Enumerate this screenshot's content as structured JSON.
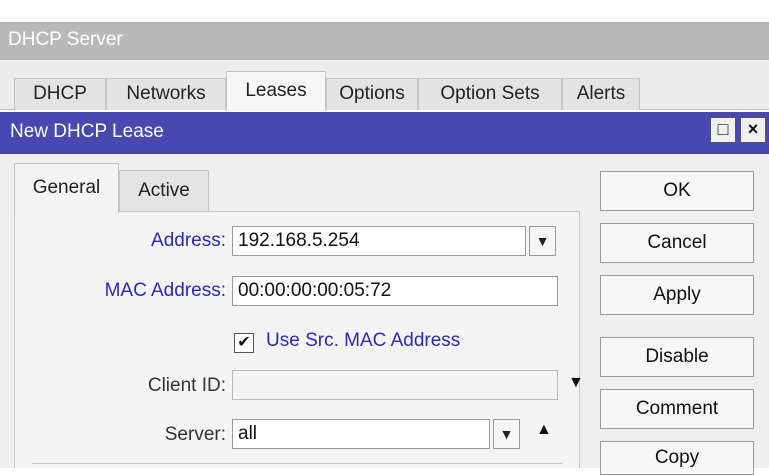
{
  "outer_window": {
    "title": "DHCP Server",
    "tabs": [
      {
        "label": "DHCP"
      },
      {
        "label": "Networks"
      },
      {
        "label": "Leases"
      },
      {
        "label": "Options"
      },
      {
        "label": "Option Sets"
      },
      {
        "label": "Alerts"
      }
    ],
    "active_tab": "Leases"
  },
  "dialog": {
    "title": "New DHCP Lease",
    "controls": {
      "restore_icon": "□",
      "close_icon": "×"
    },
    "tabs": [
      {
        "label": "General"
      },
      {
        "label": "Active"
      }
    ],
    "active_tab": "General",
    "form": {
      "address_label": "Address:",
      "address_value": "192.168.5.254",
      "mac_label": "MAC Address:",
      "mac_value": "00:00:00:00:05:72",
      "use_src_mac_label": "Use Src. MAC Address",
      "use_src_mac_checked": true,
      "client_id_label": "Client ID:",
      "client_id_value": "",
      "server_label": "Server:",
      "server_value": "all"
    },
    "buttons": {
      "ok": "OK",
      "cancel": "Cancel",
      "apply": "Apply",
      "disable": "Disable",
      "comment": "Comment",
      "copy": "Copy"
    }
  },
  "icons": {
    "dropdown_compact": "dropdown-toggle-icon",
    "expand_down": "triangle-down-icon",
    "collapse_up": "triangle-up-icon",
    "check": "checkmark-icon"
  },
  "colors": {
    "dialog_title_bg": "#4848b0",
    "outer_title_bg": "#b9b9b9",
    "label_blue": "#2a2ab8"
  }
}
